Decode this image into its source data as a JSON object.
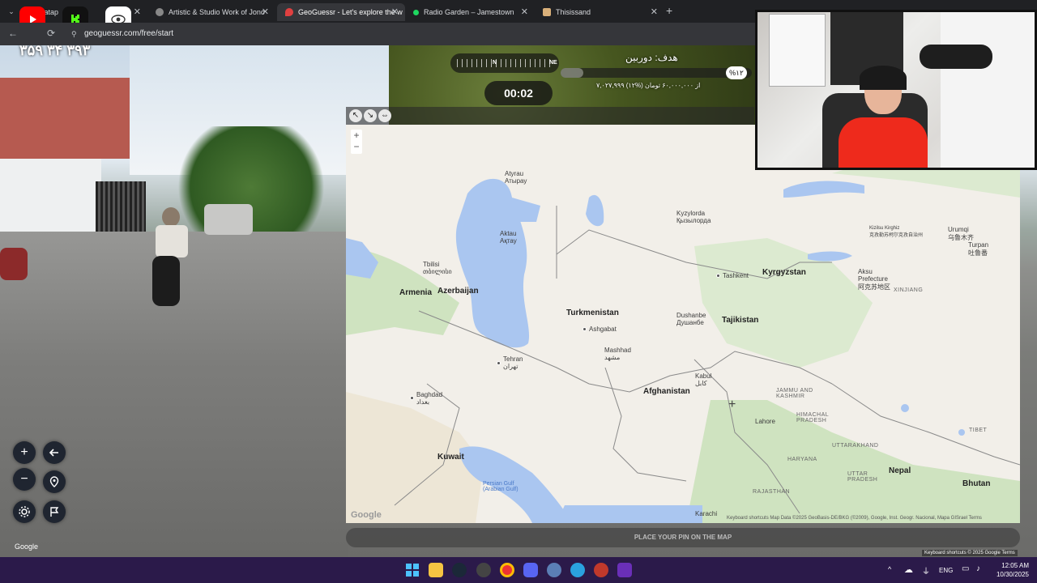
{
  "browser": {
    "tabs": [
      {
        "label": "tatap"
      },
      {
        "label": "Artistic & Studio Work of Jono"
      },
      {
        "label": "GeoGuessr - Let's explore the w"
      },
      {
        "label": "Radio Garden – Jamestown"
      },
      {
        "label": "Thisissand"
      }
    ],
    "url": "geoguessr.com/free/start",
    "close_glyph": "✕",
    "new_tab_glyph": "+"
  },
  "streetview": {
    "overlay_number": "۳۵۹ ۳۴ ۳۹۳",
    "google_label": "Google",
    "attribution": "Keyboard shortcuts  © 2025 Google  Terms"
  },
  "hud": {
    "compass_n": "N",
    "compass_ne": "NE",
    "timer": "00:02",
    "goal": "هدف: دوربین",
    "goal_percent": "%۱۲",
    "goal_progress": 0.12,
    "goal_amount": "۷,۰۲۷,۹۹۹ از ۶۰,۰۰۰,۰۰۰ تومان (%۱۲)"
  },
  "map": {
    "countries": [
      {
        "name": "Kyrgyzstan"
      },
      {
        "name": "Armenia"
      },
      {
        "name": "Azerbaijan"
      },
      {
        "name": "Turkmenistan"
      },
      {
        "name": "Tajikistan"
      },
      {
        "name": "Afghanistan"
      },
      {
        "name": "Kuwait"
      },
      {
        "name": "Nepal"
      },
      {
        "name": "Bhutan"
      }
    ],
    "cities": [
      {
        "name": "Atyrau\nАтырау"
      },
      {
        "name": "Kyzylorda\nҚызылорда"
      },
      {
        "name": "Aktau\nАқтау"
      },
      {
        "name": "Tbilisi\nთბილისი"
      },
      {
        "name": "Ashgabat"
      },
      {
        "name": "Mashhad\nمشهد"
      },
      {
        "name": "Tashkent"
      },
      {
        "name": "Dushanbe\nДушанбе"
      },
      {
        "name": "Tehran\nتهران"
      },
      {
        "name": "Kabul\nکابل"
      },
      {
        "name": "Baghdad\nبغداد"
      },
      {
        "name": "Lahore"
      },
      {
        "name": "Karachi"
      },
      {
        "name": "Urumqi\n乌鲁木齐"
      },
      {
        "name": "Turpan\n吐鲁番"
      },
      {
        "name": "Aksu\nPrefecture\n阿克苏地区"
      },
      {
        "name": "Kizilsu Kirghiz\n克孜勒苏柯尔克孜自治州"
      }
    ],
    "regions": [
      {
        "name": "XINJIANG"
      },
      {
        "name": "JAMMU AND\nKASHMIR"
      },
      {
        "name": "HIMACHAL\nPRADESH"
      },
      {
        "name": "TIBET"
      },
      {
        "name": "HARYANA"
      },
      {
        "name": "UTTARAKHAND"
      },
      {
        "name": "UTTAR\nPRADESH"
      },
      {
        "name": "RAJASTHAN"
      }
    ],
    "water": [
      {
        "name": "Persian Gulf\n(Arabian Gulf)"
      }
    ],
    "zoom_in": "+",
    "zoom_out": "−",
    "google_label": "Google",
    "attribution": "Keyboard shortcuts   Map Data ©2025 GeoBasis-DE/BKG (©2009), Google, Inst. Geogr. Nacional, Mapa GISrael   Terms",
    "place_pin": "PLACE YOUR PIN ON THE MAP"
  },
  "taskbar": {
    "time": "12:05 AM",
    "date": "10/30/2025",
    "lang": "ENG"
  },
  "colors": {
    "water": "#aac6f0",
    "land": "#f2efe9",
    "green": "#cfe3c0",
    "taskbar": "#2b1a4a"
  }
}
